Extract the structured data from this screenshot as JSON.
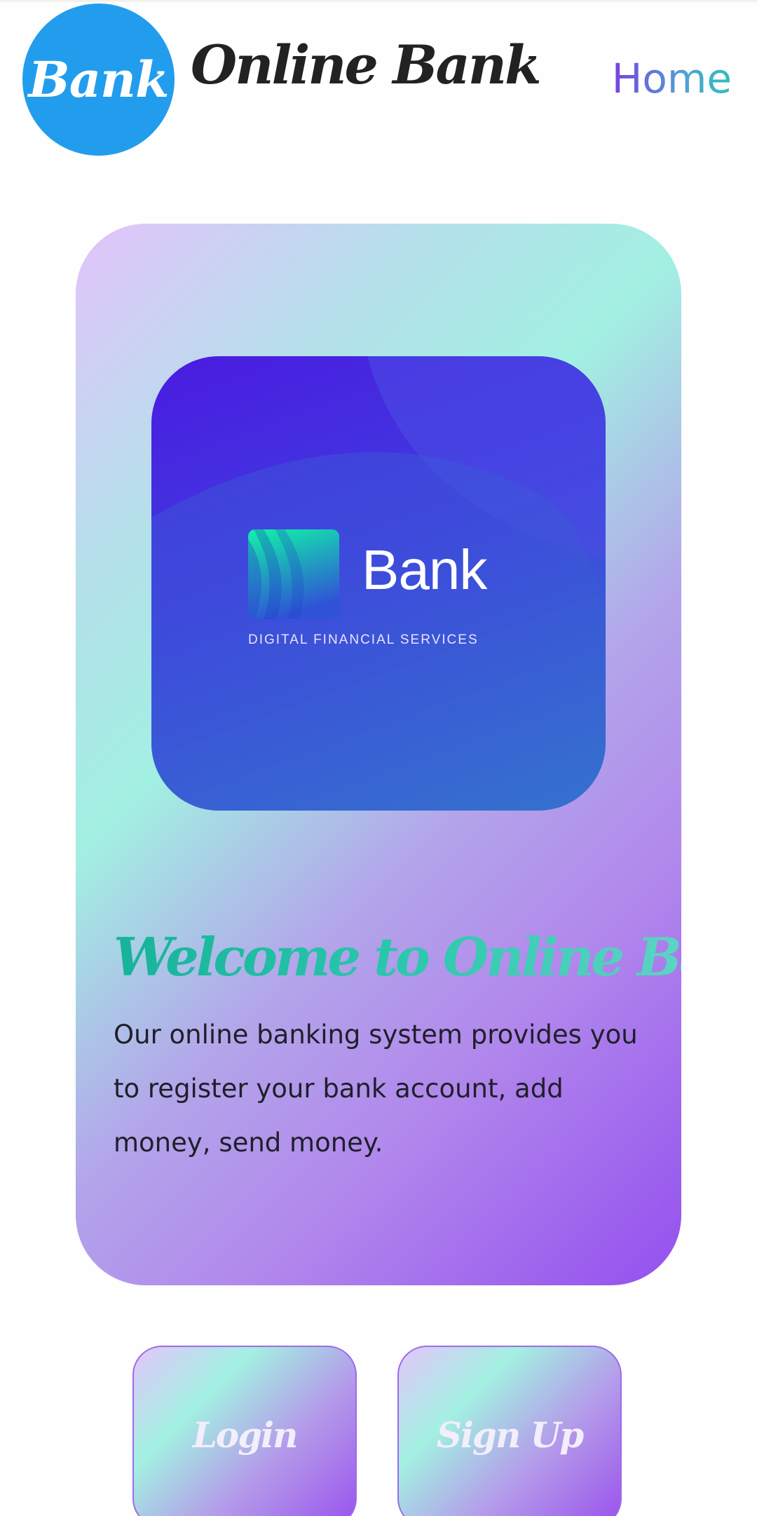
{
  "header": {
    "logo_text": "Bank",
    "brand_name": "Online Bank",
    "nav_home": "Home"
  },
  "hero": {
    "tile_word": "Bank",
    "tile_tagline": "DIGITAL FINANCIAL SERVICES",
    "title": "Welcome to Online Bank",
    "description": "Our online banking system provides you to register your bank account, add money, send money."
  },
  "actions": {
    "login_label": "Login",
    "signup_label": "Sign Up"
  },
  "colors": {
    "logo_circle": "#229ded",
    "title_gradient_start": "#16b39a",
    "card_purple": "#9450ee"
  }
}
